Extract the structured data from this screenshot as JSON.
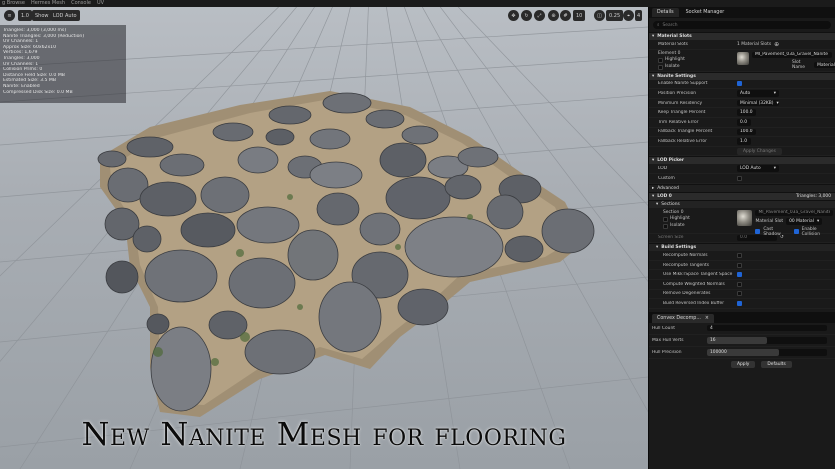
{
  "topbar": {
    "items": [
      "g Browse",
      "Hermes Mesh",
      "Console",
      "UV"
    ]
  },
  "viewport": {
    "toolbar": {
      "left": [
        "1.0",
        "Show",
        "LOD Auto"
      ],
      "right": [
        "10",
        "0.25",
        "4"
      ]
    },
    "stats": [
      "Triangles: 3,000 (3,000 ms)",
      "Nanite Triangles: 3,000 (Reduction)",
      "UV Channels: 1",
      "Approx Size: 60x62x10",
      "Vertices: 1,679",
      "Triangles: 3,000",
      "UV Channels: 1",
      "Collision Prims: 0",
      "Distance Field Size: 0.0 MB",
      "Estimated Size: 3.5 MB",
      "Nanite: Enabled",
      "Compressed Disk Size: 0.0 MB"
    ],
    "overlay_title": "New Nanite Mesh for flooring"
  },
  "panel": {
    "tabs": [
      "Details",
      "Socket Manager"
    ],
    "search_placeholder": "Search",
    "material_slots": {
      "header": "Material Slots",
      "slots_label": "Material Slots",
      "slots_count": "1 Material Slots",
      "element_label": "Element 0",
      "highlight_label": "Highlight",
      "isolate_label": "Isolate",
      "material_name": "MI_Pavement_03a_Gravel_Nanite",
      "slot_name_label": "Slot Name",
      "slot_name_value": "Material"
    },
    "nanite": {
      "header": "Nanite Settings",
      "rows": [
        {
          "label": "Enable Nanite Support",
          "type": "check",
          "value": true
        },
        {
          "label": "Position Precision",
          "type": "dropdown",
          "value": "Auto"
        },
        {
          "label": "Minimum Residency",
          "type": "dropdown",
          "value": "Minimal (32KB)"
        },
        {
          "label": "Keep Triangle Percent",
          "type": "field",
          "value": "100.0"
        },
        {
          "label": "Trim Relative Error",
          "type": "field",
          "value": "0.0"
        },
        {
          "label": "Fallback Triangle Percent",
          "type": "field",
          "value": "100.0"
        },
        {
          "label": "Fallback Relative Error",
          "type": "field",
          "value": "1.0"
        }
      ],
      "apply_button": "Apply Changes"
    },
    "lod_picker": {
      "header": "LOD Picker",
      "lod_label": "LOD",
      "lod_value": "LOD Auto",
      "custom_label": "Custom"
    },
    "advanced_label": "Advanced",
    "lod0": {
      "header": "LOD 0",
      "triangles": "Triangles: 3,000",
      "sections_header": "Sections",
      "section_element": "Section 0",
      "section_highlight": "Highlight",
      "section_isolate": "Isolate",
      "section_material": "MI_Pavement_03a_Gravel_Nanite",
      "material_slot_label": "Material Slot",
      "material_slot_value": "00 Material",
      "cast_shadow_label": "Cast Shadow",
      "enable_collision_label": "Enable Collision",
      "screen_size_label": "Screen Size",
      "screen_size_value": "0.0"
    },
    "build": {
      "header": "Build Settings",
      "rows": [
        {
          "label": "Recompute Normals",
          "value": false
        },
        {
          "label": "Recompute Tangents",
          "value": false
        },
        {
          "label": "Use MikkTSpace Tangent Space",
          "value": true
        },
        {
          "label": "Compute Weighted Normals",
          "value": false
        },
        {
          "label": "Remove Degenerates",
          "value": false
        },
        {
          "label": "Build Reversed Index Buffer",
          "value": true
        }
      ]
    },
    "convex": {
      "tab_label": "Convex Decomp...",
      "hull_count_label": "Hull Count",
      "hull_count_value": "4",
      "max_hull_verts_label": "Max Hull Verts",
      "max_hull_verts_value": "16",
      "max_hull_verts_fraction": 0.5,
      "hull_precision_label": "Hull Precision",
      "hull_precision_value": "100000",
      "hull_precision_fraction": 0.6,
      "apply_button": "Apply",
      "defaults_button": "Defaults"
    }
  },
  "colors": {
    "accent": "#1f64d6",
    "panel_bg": "#1a1a1a"
  }
}
